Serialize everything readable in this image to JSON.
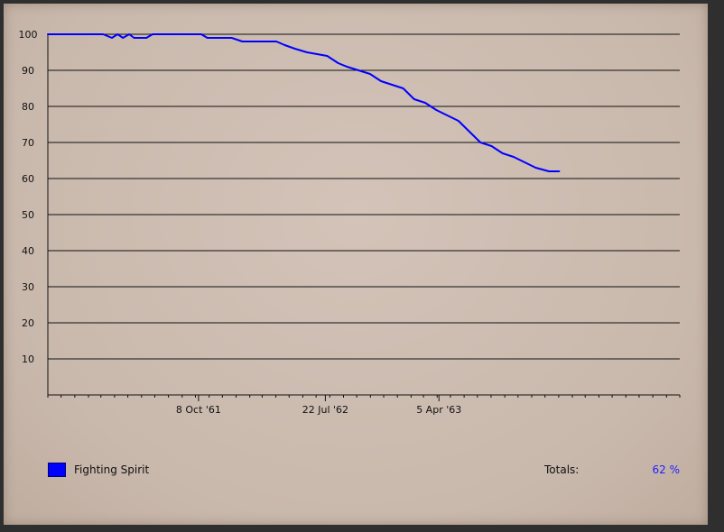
{
  "chart_data": {
    "type": "line",
    "ylim": [
      0,
      100
    ],
    "yticks": [
      10,
      20,
      30,
      40,
      50,
      60,
      70,
      80,
      90,
      100
    ],
    "yticklabels": [
      "10",
      "20",
      "30",
      "40",
      "50",
      "60",
      "70",
      "80",
      "90",
      "100"
    ],
    "xlim": [
      "1960-11-01",
      "1964-10-01"
    ],
    "xticks": [
      "1961-10-08",
      "1962-07-22",
      "1963-04-05"
    ],
    "xticklabels": [
      "8 Oct '61",
      "22 Jul '62",
      "5 Apr '63"
    ],
    "grid": true,
    "legend_position": "bottom-left",
    "series": [
      {
        "name": "Fighting Spirit",
        "color": "#0000ff",
        "points": [
          [
            "1960-11-01",
            100
          ],
          [
            "1961-03-06",
            100
          ],
          [
            "1961-03-26",
            99
          ],
          [
            "1961-04-08",
            100
          ],
          [
            "1961-04-20",
            99
          ],
          [
            "1961-05-04",
            100
          ],
          [
            "1961-05-15",
            99
          ],
          [
            "1961-06-12",
            99
          ],
          [
            "1961-06-26",
            100
          ],
          [
            "1961-10-14",
            100
          ],
          [
            "1961-10-28",
            99
          ],
          [
            "1961-12-22",
            99
          ],
          [
            "1962-01-15",
            98
          ],
          [
            "1962-04-02",
            98
          ],
          [
            "1962-04-21",
            97
          ],
          [
            "1962-05-14",
            96
          ],
          [
            "1962-06-10",
            95
          ],
          [
            "1962-07-26",
            94
          ],
          [
            "1962-08-20",
            92
          ],
          [
            "1962-09-09",
            91
          ],
          [
            "1962-10-05",
            90
          ],
          [
            "1962-10-31",
            89
          ],
          [
            "1962-11-25",
            87
          ],
          [
            "1962-12-20",
            86
          ],
          [
            "1963-01-14",
            85
          ],
          [
            "1963-02-08",
            82
          ],
          [
            "1963-03-05",
            81
          ],
          [
            "1963-03-30",
            79
          ],
          [
            "1963-04-24",
            77.5
          ],
          [
            "1963-05-19",
            76
          ],
          [
            "1963-06-13",
            73
          ],
          [
            "1963-07-08",
            70
          ],
          [
            "1963-08-02",
            69
          ],
          [
            "1963-08-27",
            67
          ],
          [
            "1963-09-21",
            66
          ],
          [
            "1963-10-16",
            64.5
          ],
          [
            "1963-11-10",
            63
          ],
          [
            "1963-12-10",
            62
          ],
          [
            "1964-01-02",
            62
          ]
        ]
      }
    ]
  },
  "legend": {
    "label": "Fighting Spirit",
    "color": "#0000ff"
  },
  "totals": {
    "label": "Totals:",
    "value": "62 %"
  }
}
